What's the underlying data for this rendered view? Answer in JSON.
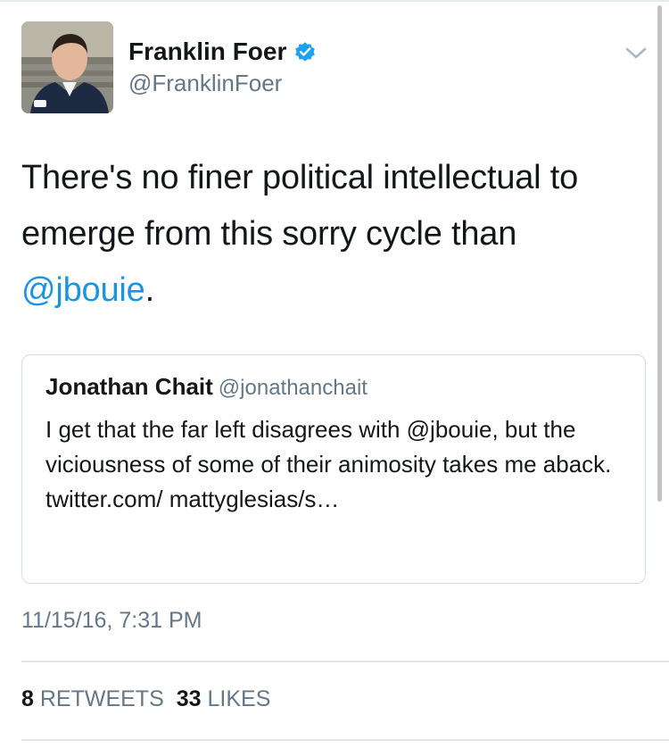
{
  "tweet": {
    "author": {
      "display_name": "Franklin Foer",
      "handle": "@FranklinFoer",
      "verified": true,
      "avatar_icon": "profile-photo"
    },
    "menu_icon": "chevron-down-icon",
    "text_part1": "There's no finer political intellectual  to emerge from this sorry cycle than ",
    "mention": "@jbouie",
    "text_part2": ".",
    "timestamp": "11/15/16, 7:31 PM",
    "retweets_count": "8",
    "retweets_label": "RETWEETS",
    "likes_count": "33",
    "likes_label": "LIKES"
  },
  "quoted_tweet": {
    "display_name": "Jonathan Chait",
    "handle": "@jonathanchait",
    "text": "I get that the far left disagrees with @jbouie, but the viciousness of some of their animosity takes me aback. twitter.com/ mattyglesias/s…"
  },
  "colors": {
    "link_blue": "#1b95e0",
    "verified_blue": "#1da1f2",
    "secondary_gray": "#657786",
    "border_gray": "#d4dde3"
  }
}
